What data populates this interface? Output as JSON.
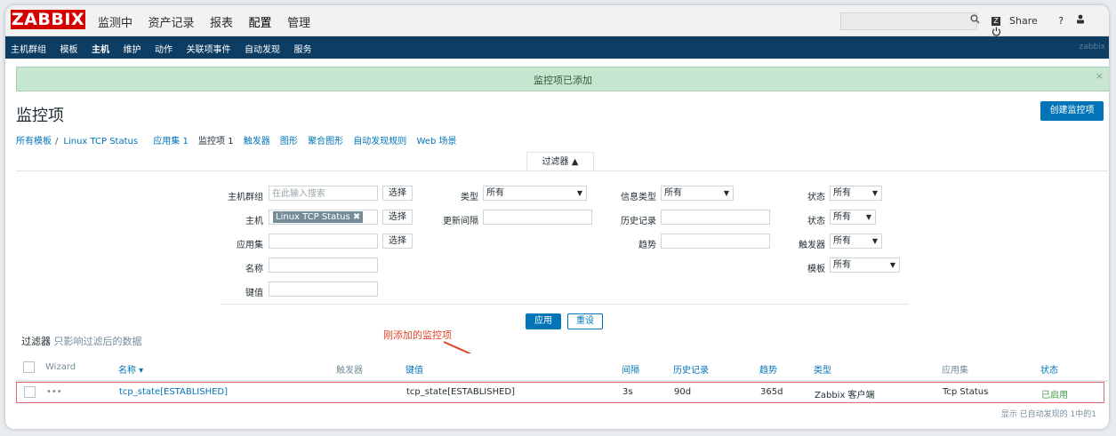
{
  "header": {
    "logo": "ZABBIX",
    "menu": [
      "监测中",
      "资产记录",
      "报表",
      "配置",
      "管理"
    ],
    "search_icon": "search-icon",
    "share_label": "Share",
    "share_icon": "Z",
    "help": "?",
    "user_icon": "user-icon",
    "logout_icon": "power-icon"
  },
  "submenu": {
    "items": [
      "主机群组",
      "模板",
      "主机",
      "维护",
      "动作",
      "关联项事件",
      "自动发现",
      "服务"
    ],
    "right": "zabbix"
  },
  "banner": {
    "message": "监控项已添加",
    "close": "×"
  },
  "page": {
    "title": "监控项",
    "create_button": "创建监控项"
  },
  "breadcrumb": {
    "all_templates": "所有模板",
    "sep": "/",
    "template": "Linux TCP Status",
    "tabs": [
      "应用集 1",
      "监控项 1",
      "触发器",
      "图形",
      "聚合图形",
      "自动发现规则",
      "Web 场景"
    ]
  },
  "filter": {
    "tab_label": "过滤器 ▲",
    "hostgroup_label": "主机群组",
    "hostgroup_placeholder": "在此输入搜索",
    "select": "选择",
    "host_label": "主机",
    "host_chip": "Linux TCP Status ✖",
    "app_label": "应用集",
    "name_label": "名称",
    "key_label": "键值",
    "type_label": "类型",
    "type_value": "所有",
    "interval_label": "更新间隔",
    "info_type_label": "信息类型",
    "info_type_value": "所有",
    "history_label": "历史记录",
    "trend_label": "趋势",
    "state_label": "状态",
    "state_value": "所有",
    "status_label": "状态",
    "status_value": "所有",
    "triggers_label": "触发器",
    "triggers_value": "所有",
    "template_label": "模板",
    "template_value": "所有",
    "apply": "应用",
    "reset": "重设",
    "note_title": "过滤器",
    "note_text": "只影响过滤后的数据"
  },
  "annotation": "刚添加的监控项",
  "table": {
    "headers": {
      "wizard": "Wizard",
      "name": "名称 ▾",
      "triggers": "触发器",
      "key": "键值",
      "interval": "间隔",
      "history": "历史记录",
      "trends": "趋势",
      "type": "类型",
      "apps": "应用集",
      "status": "状态"
    },
    "rows": [
      {
        "wizard": "•••",
        "name": "tcp_state[ESTABLISHED]",
        "triggers": "",
        "key": "tcp_state[ESTABLISHED]",
        "interval": "3s",
        "history": "90d",
        "trends": "365d",
        "type": "Zabbix 客户端",
        "apps": "Tcp Status",
        "status": "已启用"
      }
    ],
    "footer": "显示 已自动发现的 1中的1"
  },
  "colors": {
    "brand": "#d40000",
    "nav": "#0e3d64",
    "link": "#0275b8",
    "success": "#c7e6cf",
    "enabled": "#429e47"
  }
}
